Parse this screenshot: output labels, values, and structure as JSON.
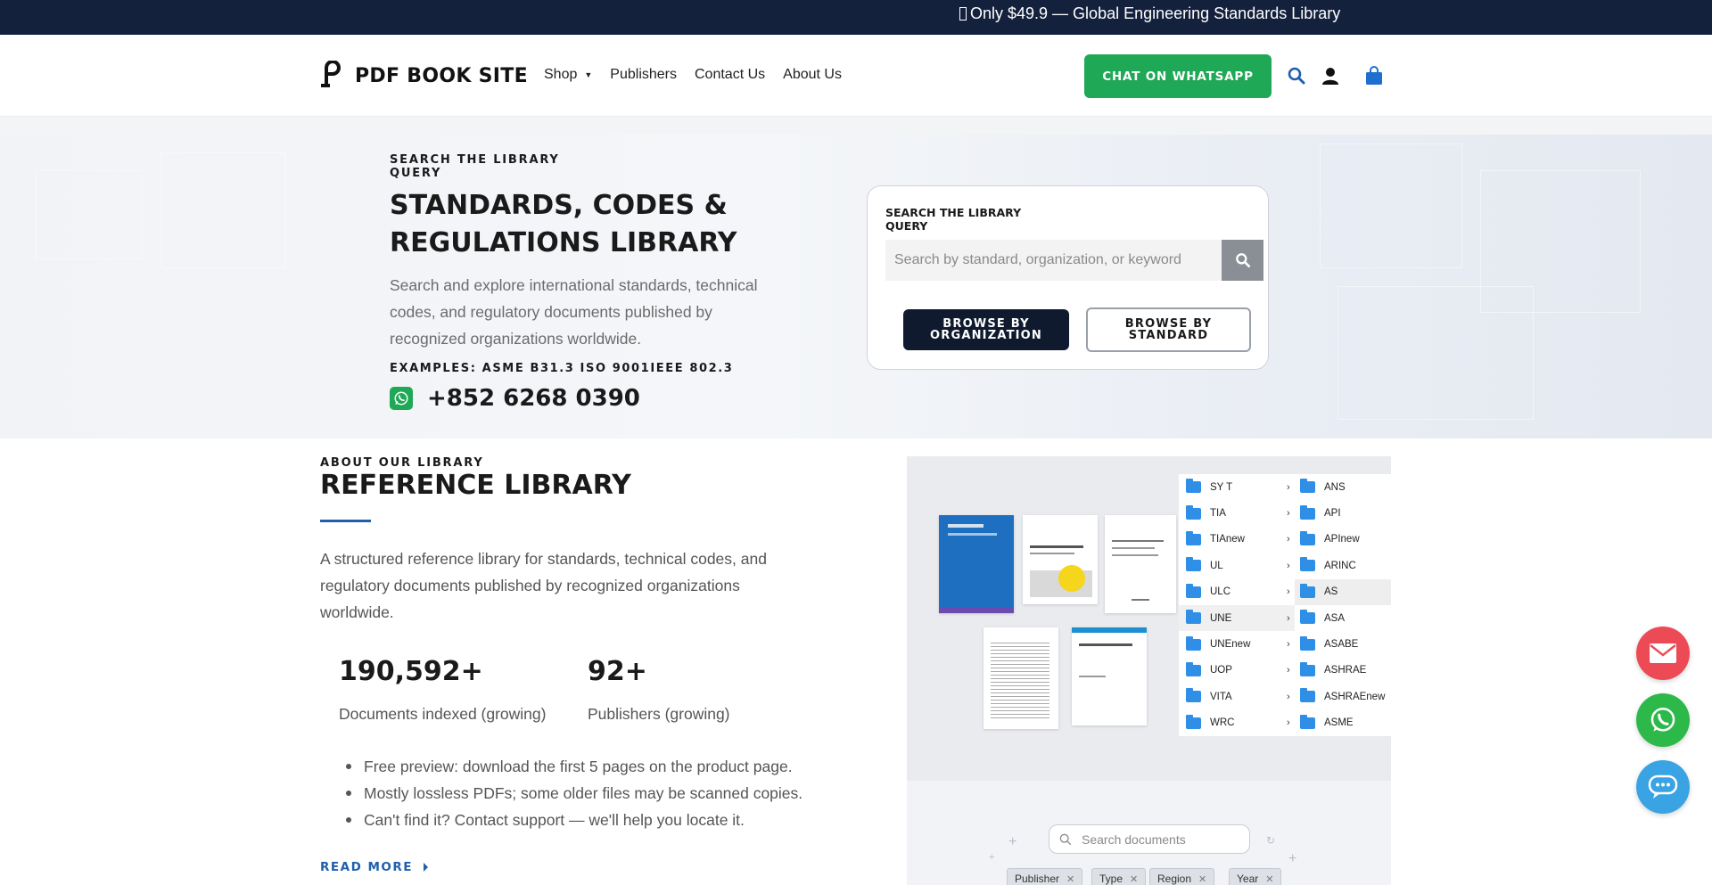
{
  "topbar": {
    "message": "Only $49.9 — Global Engineering Standards Library"
  },
  "header": {
    "logo_text": "PDF BOOK SITE",
    "nav": [
      {
        "label": "Shop",
        "has_dropdown": true
      },
      {
        "label": "Publishers"
      },
      {
        "label": "Contact Us"
      },
      {
        "label": "About Us"
      }
    ],
    "whatsapp_button": "CHAT ON WHATSAPP",
    "icons": [
      "search-icon",
      "user-icon",
      "cart-icon"
    ],
    "accent_color": "#1fa855"
  },
  "hero": {
    "eyebrow": "SEARCH THE LIBRARY QUERY",
    "title": "STANDARDS, CODES & REGULATIONS LIBRARY",
    "description": "Search and explore international standards, technical codes, and regulatory documents published by recognized organizations worldwide.",
    "examples": "EXAMPLES: ASME B31.3 ISO 9001IEEE 802.3",
    "phone": "+852 6268 0390",
    "search_card": {
      "label": "SEARCH THE LIBRARY QUERY",
      "placeholder": "Search by standard, organization, or keyword",
      "value": "",
      "browse_org": "BROWSE BY ORGANIZATION",
      "browse_std": "BROWSE BY STANDARD"
    }
  },
  "about": {
    "eyebrow": "ABOUT OUR LIBRARY",
    "title": "REFERENCE LIBRARY",
    "description": "A structured reference library for standards, technical codes, and regulatory documents published by recognized organizations worldwide.",
    "stats": [
      {
        "value": "190,592+",
        "label": "Documents indexed (growing)"
      },
      {
        "value": "92+",
        "label": "Publishers (growing)"
      }
    ],
    "bullets": [
      "Free preview: download the first 5 pages on the product page.",
      "Mostly lossless PDFs; some older files may be scanned copies.",
      "Can't find it? Contact support — we'll help you locate it."
    ],
    "read_more": "READ MORE"
  },
  "library_image": {
    "folders_left": [
      "SY T",
      "TIA",
      "TIAnew",
      "UL",
      "ULC",
      "UNE",
      "UNEnew",
      "UOP",
      "VITA",
      "WRC"
    ],
    "folders_right": [
      "ANS",
      "API",
      "APInew",
      "ARINC",
      "AS",
      "ASA",
      "ASABE",
      "ASHRAE",
      "ASHRAEnew",
      "ASME"
    ],
    "search_placeholder": "Search documents",
    "filters": [
      "Publisher",
      "Type",
      "Region",
      "Year"
    ]
  },
  "floating": [
    "mail-icon",
    "whatsapp-icon",
    "chat-icon"
  ]
}
